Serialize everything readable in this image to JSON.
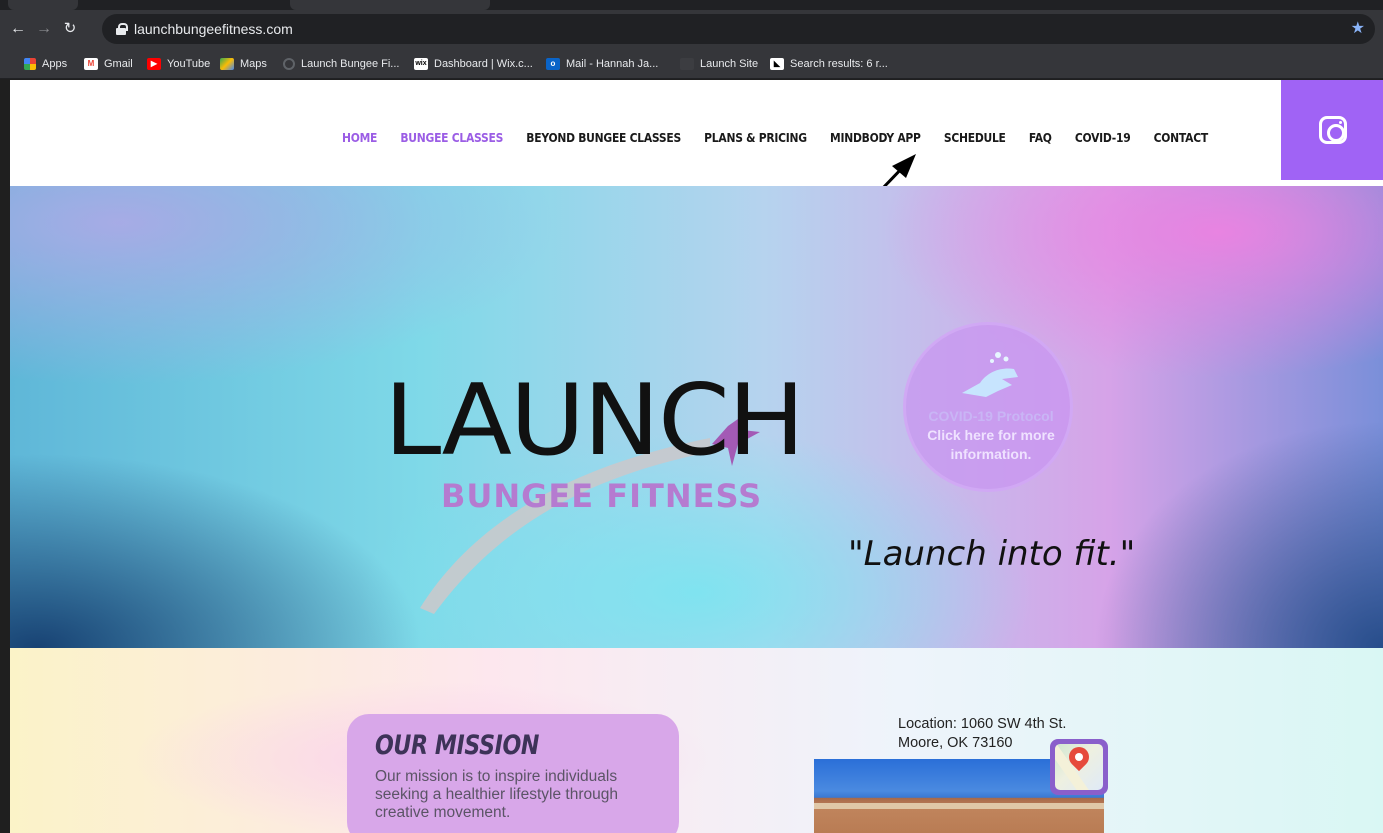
{
  "browser": {
    "url": "launchbungeefitness.com",
    "bookmarks": [
      {
        "label": "Apps",
        "icon": "apps-grid-icon"
      },
      {
        "label": "Gmail",
        "icon": "gmail-icon"
      },
      {
        "label": "YouTube",
        "icon": "youtube-icon"
      },
      {
        "label": "Maps",
        "icon": "maps-icon"
      },
      {
        "label": "Launch Bungee Fi...",
        "icon": "loading-icon"
      },
      {
        "label": "Dashboard | Wix.c...",
        "icon": "wix-icon"
      },
      {
        "label": "Mail - Hannah Ja...",
        "icon": "outlook-icon"
      },
      {
        "label": "Launch Site",
        "icon": "blank-icon"
      },
      {
        "label": "Search results: 6 r...",
        "icon": "search-results-icon"
      }
    ]
  },
  "nav": {
    "items": [
      "HOME",
      "BUNGEE CLASSES",
      "BEYOND BUNGEE CLASSES",
      "PLANS & PRICING",
      "MINDBODY APP",
      "SCHEDULE",
      "FAQ",
      "COVID-19",
      "CONTACT"
    ],
    "active_items": [
      "HOME",
      "BUNGEE CLASSES"
    ],
    "active_color": "#9b5de5",
    "social_color": "#a063f5"
  },
  "hero": {
    "logo_word": "LAUNCH",
    "logo_sub": "BUNGEE FITNESS",
    "covid_badge": {
      "line1": "COVID-19 Protocol",
      "line2": "Click here for more information."
    },
    "tagline": "\"Launch into fit.\""
  },
  "mission": {
    "title": "OUR MISSION",
    "body": "Our mission is to inspire individuals seeking a healthier lifestyle through creative movement."
  },
  "location": {
    "line1": "Location: 1060 SW 4th St.",
    "line2": "Moore, OK 73160"
  }
}
